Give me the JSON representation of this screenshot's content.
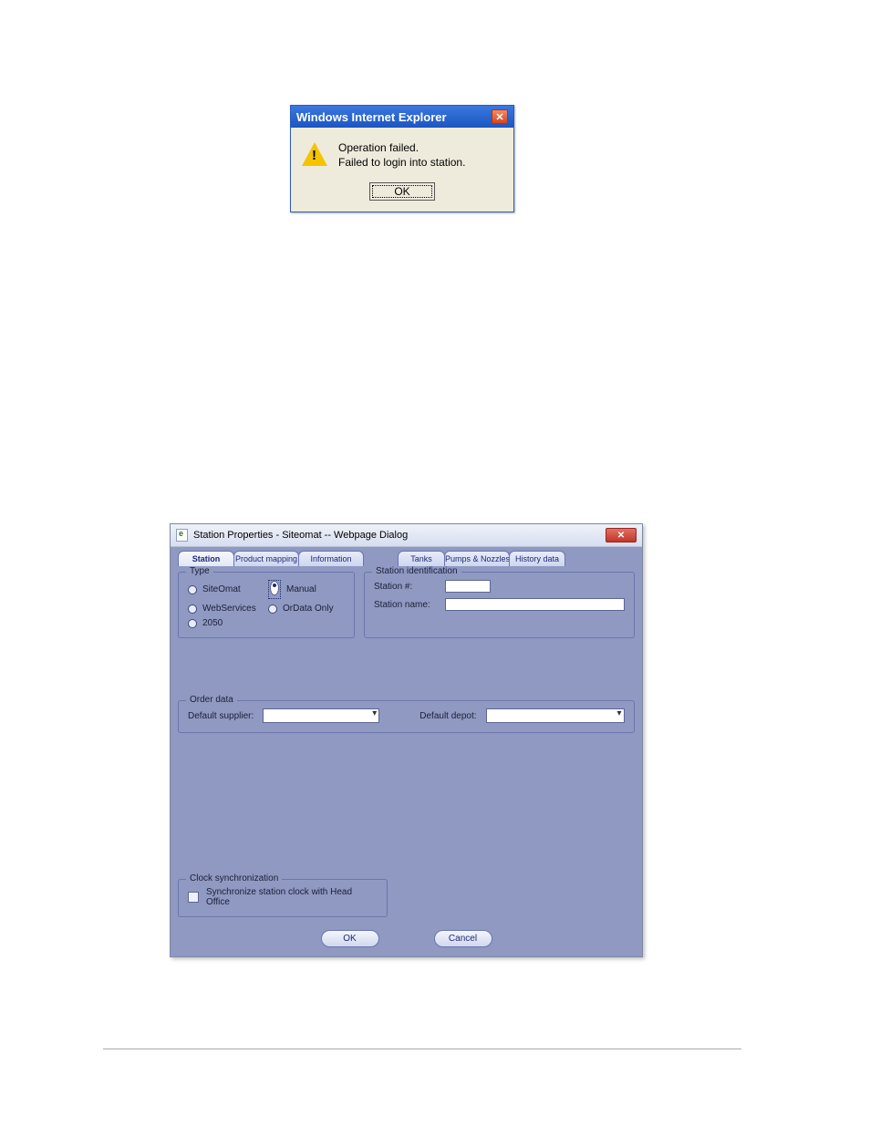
{
  "ie_dialog": {
    "title": "Windows Internet Explorer",
    "msg_line1": "Operation failed.",
    "msg_line2": "Failed to login into station.",
    "ok_label": "OK",
    "close_glyph": "✕"
  },
  "sp_dialog": {
    "title": "Station Properties - Siteomat -- Webpage Dialog",
    "close_glyph": "✕",
    "tabs": {
      "t0": "Station",
      "t1": "Product mapping",
      "t2": "Information",
      "t3": "Tanks",
      "t4": "Pumps & Nozzles",
      "t5": "History data"
    },
    "type_group": {
      "legend": "Type",
      "siteomat": "SiteOmat",
      "manual": "Manual",
      "webservices": "WebServices",
      "ordata": "OrData Only",
      "y2050": "2050"
    },
    "ident_group": {
      "legend": "Station identification",
      "station_no_label": "Station #:",
      "station_name_label": "Station name:",
      "station_no_value": "",
      "station_name_value": ""
    },
    "order_group": {
      "legend": "Order data",
      "supplier_label": "Default supplier:",
      "depot_label": "Default depot:",
      "supplier_value": "",
      "depot_value": ""
    },
    "clock_group": {
      "legend": "Clock synchronization",
      "sync_label": "Synchronize station clock with Head Office"
    },
    "footer": {
      "ok": "OK",
      "cancel": "Cancel"
    }
  }
}
